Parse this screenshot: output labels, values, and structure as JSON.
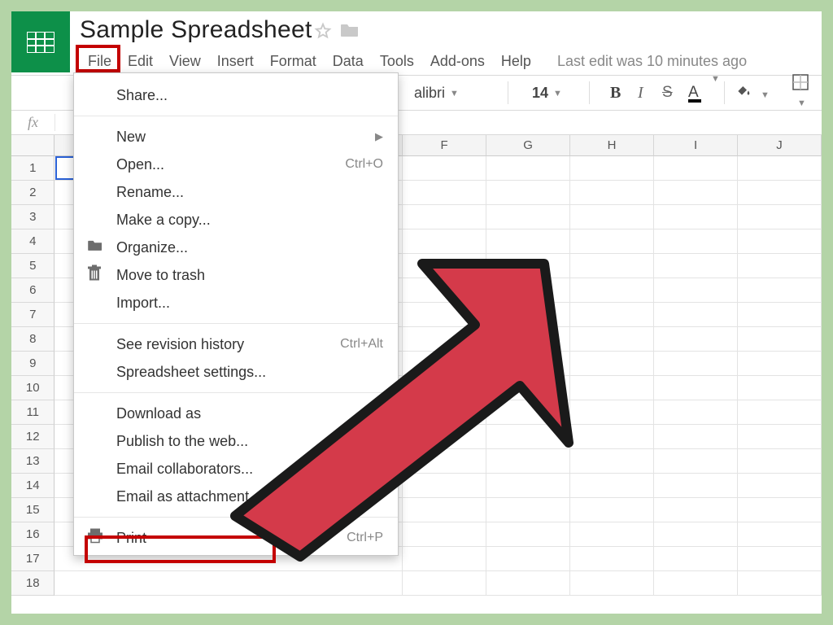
{
  "doc": {
    "title": "Sample Spreadsheet"
  },
  "menubar": {
    "file": "File",
    "edit": "Edit",
    "view": "View",
    "insert": "Insert",
    "format": "Format",
    "data": "Data",
    "tools": "Tools",
    "addons": "Add-ons",
    "help": "Help",
    "last_edit": "Last edit was 10 minutes ago"
  },
  "toolbar": {
    "font": "alibri",
    "fontsize": "14",
    "bold": "B",
    "italic": "I",
    "strike": "S",
    "textcolor": "A"
  },
  "formula": {
    "fx": "fx"
  },
  "columns": [
    "F",
    "G",
    "H",
    "I",
    "J"
  ],
  "rows": [
    "1",
    "2",
    "3",
    "4",
    "5",
    "6",
    "7",
    "8",
    "9",
    "10",
    "11",
    "12",
    "13",
    "14",
    "15",
    "16",
    "17",
    "18"
  ],
  "file_menu": {
    "share": "Share...",
    "new": "New",
    "open": "Open...",
    "open_shortcut": "Ctrl+O",
    "rename": "Rename...",
    "make_copy": "Make a copy...",
    "organize": "Organize...",
    "move_trash": "Move to trash",
    "import": "Import...",
    "revision": "See revision history",
    "revision_shortcut": "Ctrl+Alt",
    "settings": "Spreadsheet settings...",
    "download": "Download as",
    "publish": "Publish to the web...",
    "email_collab": "Email collaborators...",
    "email_attach": "Email as attachment...",
    "print": "Print",
    "print_shortcut": "Ctrl+P"
  }
}
